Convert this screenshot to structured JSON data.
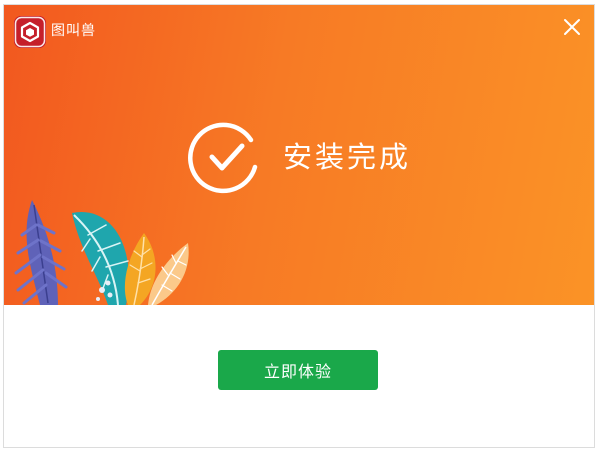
{
  "window": {
    "app_name": "图叫兽",
    "close_icon": "close-icon",
    "logo_icon": "app-logo-icon"
  },
  "hero": {
    "status_icon": "check-circle-icon",
    "status_text": "安装完成",
    "gradient_start": "#f2581f",
    "gradient_end": "#fb9326"
  },
  "footer": {
    "action_button_label": "立即体验",
    "action_button_color": "#1aa84a"
  }
}
